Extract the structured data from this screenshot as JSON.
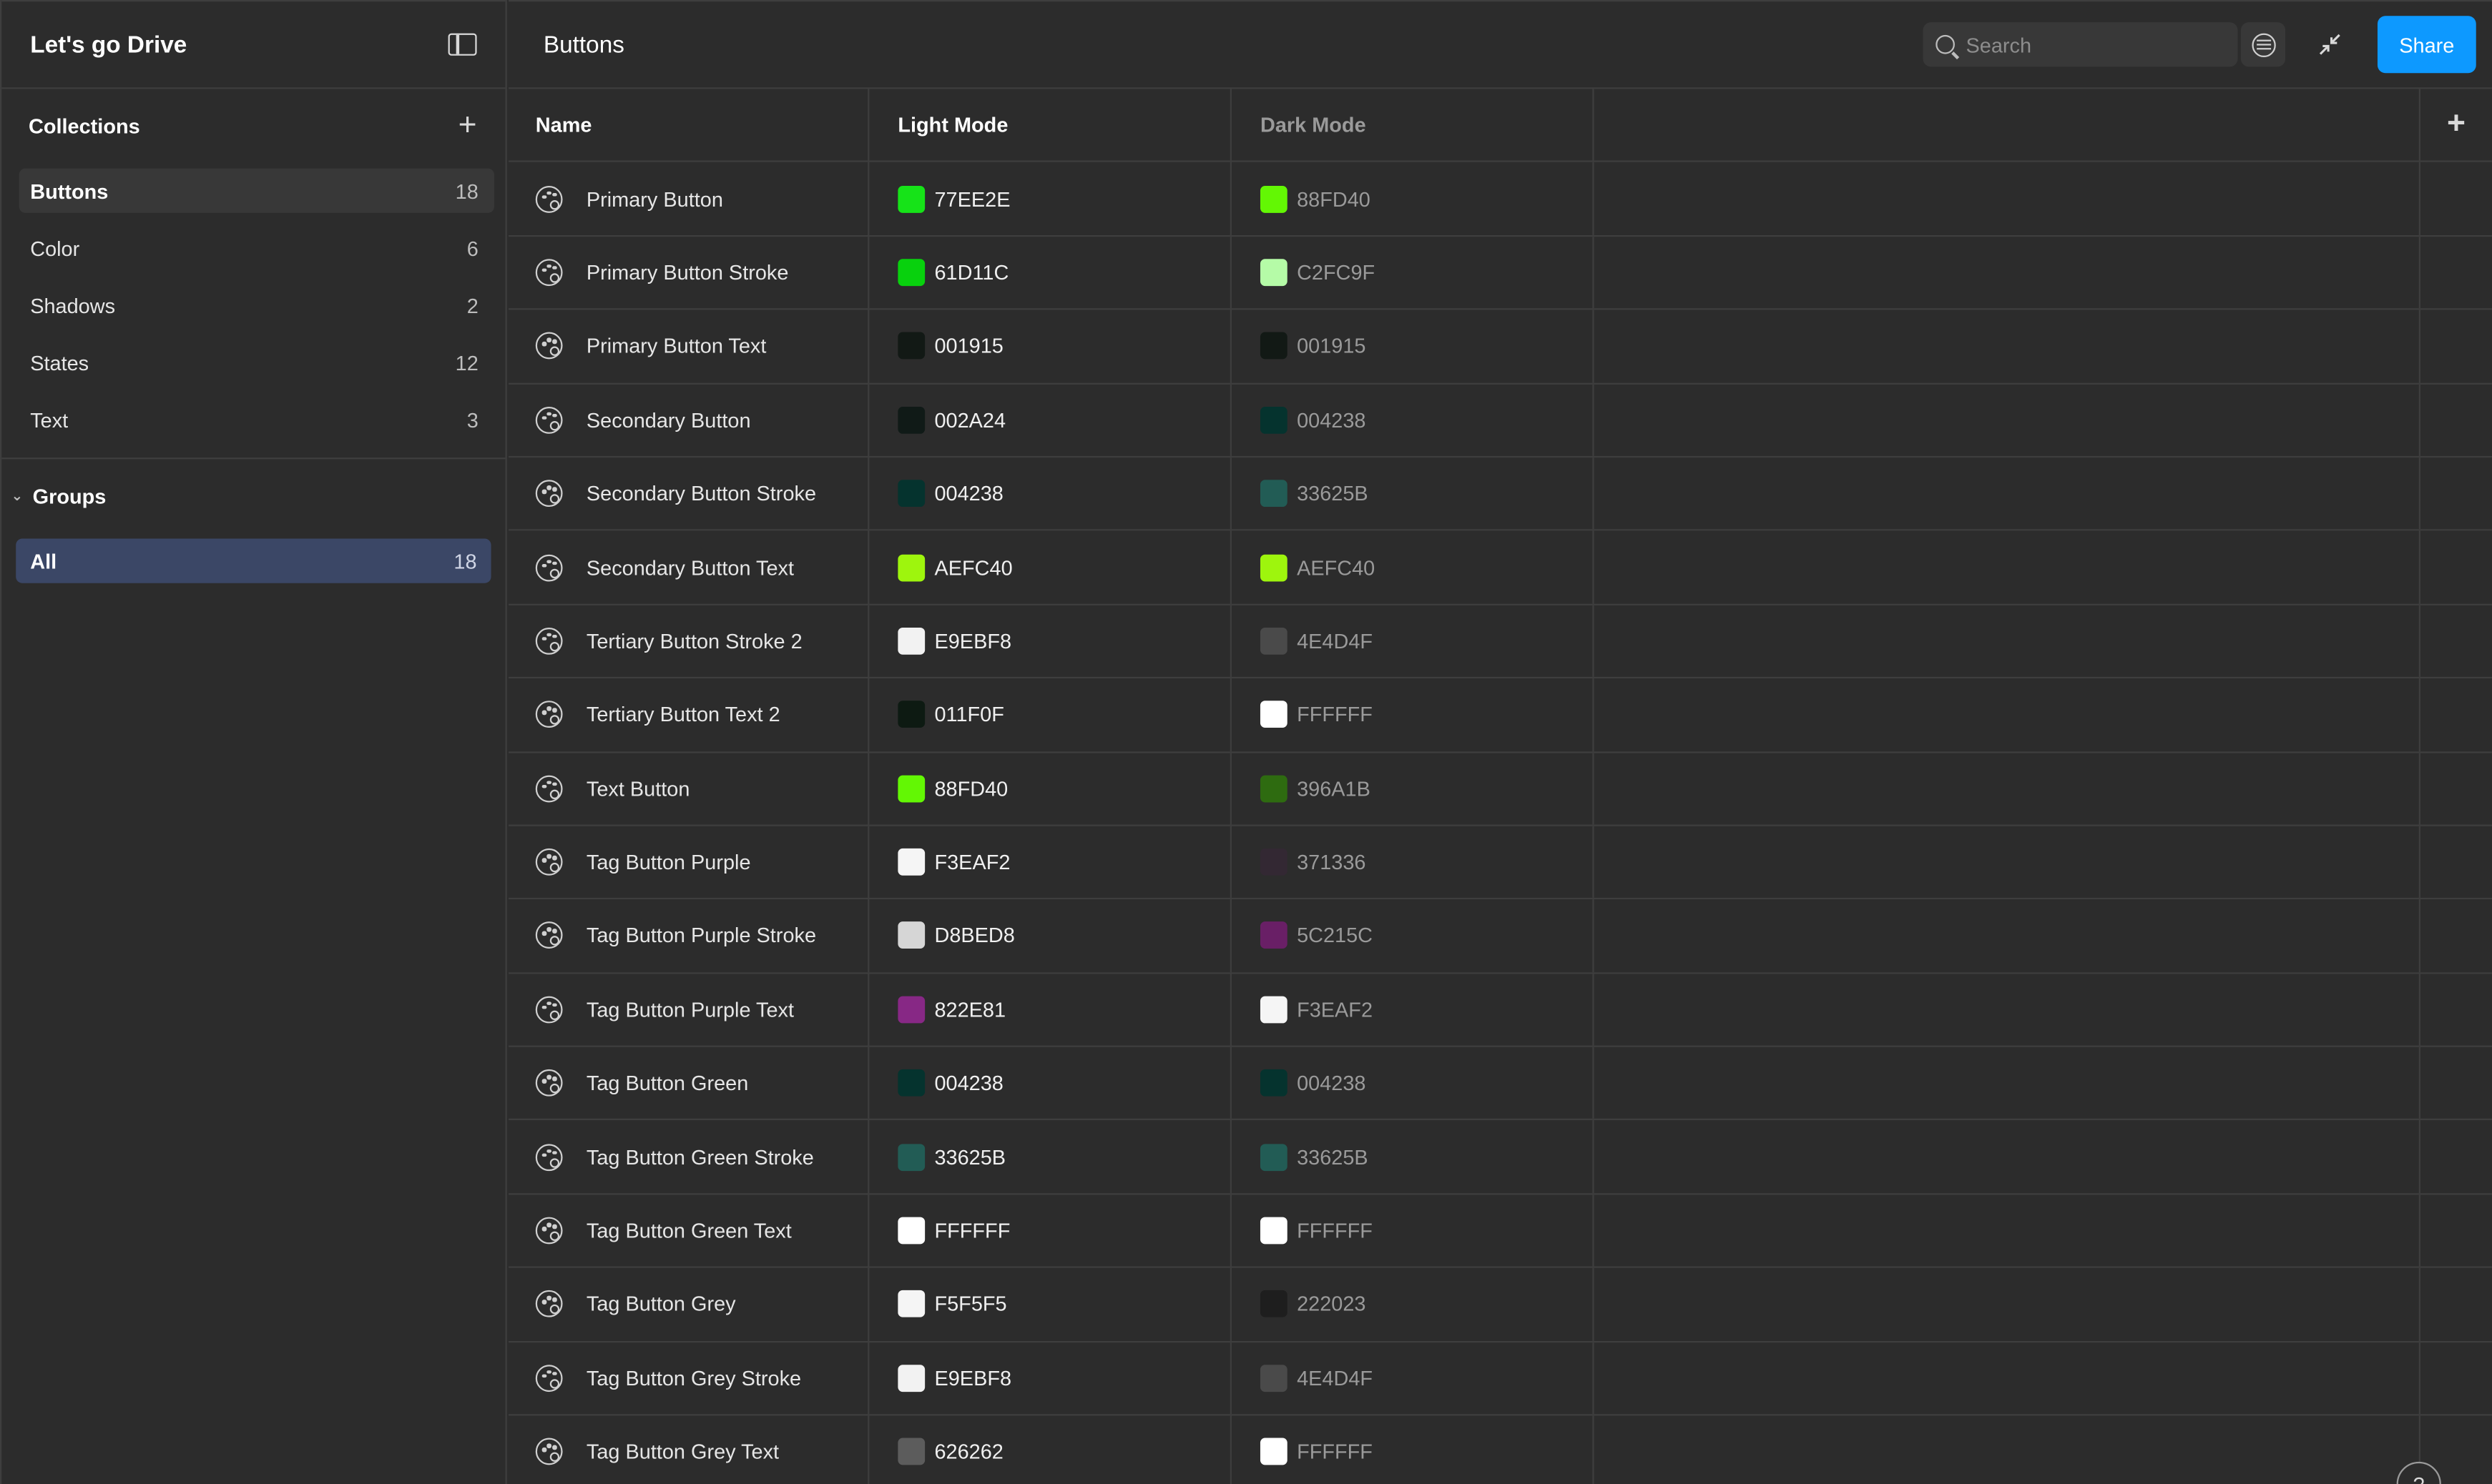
{
  "app": {
    "title": "Let's go Drive"
  },
  "sidebar": {
    "collections_label": "Collections",
    "collections": [
      {
        "label": "Buttons",
        "count": "18",
        "active": true
      },
      {
        "label": "Color",
        "count": "6"
      },
      {
        "label": "Shadows",
        "count": "2"
      },
      {
        "label": "States",
        "count": "12"
      },
      {
        "label": "Text",
        "count": "3"
      }
    ],
    "groups_label": "Groups",
    "groups": [
      {
        "label": "All",
        "count": "18",
        "active": true
      }
    ]
  },
  "header": {
    "title": "Buttons",
    "search_placeholder": "Search",
    "share_label": "Share"
  },
  "table": {
    "columns": [
      "Name",
      "Light Mode",
      "Dark Mode"
    ],
    "rows": [
      {
        "name": "Primary Button",
        "light": "77EE2E",
        "dark": "88FD40",
        "light_color": "#16e318",
        "dark_color": "#63f704"
      },
      {
        "name": "Primary Button Stroke",
        "light": "61D11C",
        "dark": "C2FC9F",
        "light_color": "#08d10d",
        "dark_color": "#b5fba7"
      },
      {
        "name": "Primary Button Text",
        "light": "001915",
        "dark": "001915",
        "light_color": "#121915",
        "dark_color": "#121915"
      },
      {
        "name": "Secondary Button",
        "light": "002A24",
        "dark": "004238",
        "light_color": "#101a17",
        "dark_color": "#05332e"
      },
      {
        "name": "Secondary Button Stroke",
        "light": "004238",
        "dark": "33625B",
        "light_color": "#05332e",
        "dark_color": "#225c55"
      },
      {
        "name": "Secondary Button Text",
        "light": "AEFC40",
        "dark": "AEFC40",
        "light_color": "#9ef50d",
        "dark_color": "#9ef50d"
      },
      {
        "name": "Tertiary Button Stroke 2",
        "light": "E9EBF8",
        "dark": "4E4D4F",
        "light_color": "#f2f2f2",
        "dark_color": "#4a4a4a"
      },
      {
        "name": "Tertiary Button Text 2",
        "light": "011F0F",
        "dark": "FFFFFF",
        "light_color": "#0d1a12",
        "dark_color": "#ffffff"
      },
      {
        "name": "Text Button",
        "light": "88FD40",
        "dark": "396A1B",
        "light_color": "#63f704",
        "dark_color": "#2e6b10"
      },
      {
        "name": "Tag Button Purple",
        "light": "F3EAF2",
        "dark": "371336",
        "light_color": "#f5f5f5",
        "dark_color": "#332833"
      },
      {
        "name": "Tag Button Purple Stroke",
        "light": "D8BED8",
        "dark": "5C215C",
        "light_color": "#d6d6d6",
        "dark_color": "#691f66"
      },
      {
        "name": "Tag Button Purple Text",
        "light": "822E81",
        "dark": "F3EAF2",
        "light_color": "#872885",
        "dark_color": "#f5f5f5"
      },
      {
        "name": "Tag Button Green",
        "light": "004238",
        "dark": "004238",
        "light_color": "#05332e",
        "dark_color": "#05332e"
      },
      {
        "name": "Tag Button Green Stroke",
        "light": "33625B",
        "dark": "33625B",
        "light_color": "#225c55",
        "dark_color": "#225c55"
      },
      {
        "name": "Tag Button Green Text",
        "light": "FFFFFF",
        "dark": "FFFFFF",
        "light_color": "#ffffff",
        "dark_color": "#ffffff"
      },
      {
        "name": "Tag Button Grey",
        "light": "F5F5F5",
        "dark": "222023",
        "light_color": "#f5f5f5",
        "dark_color": "#1e1e1e"
      },
      {
        "name": "Tag Button Grey Stroke",
        "light": "E9EBF8",
        "dark": "4E4D4F",
        "light_color": "#f2f2f2",
        "dark_color": "#4a4a4a"
      },
      {
        "name": "Tag Button Grey Text",
        "light": "626262",
        "dark": "FFFFFF",
        "light_color": "#5c5c5c",
        "dark_color": "#ffffff"
      }
    ]
  },
  "help": {
    "label": "?"
  },
  "colors": {
    "accent": "#0d99ff",
    "group_active_bg": "#3b4766"
  }
}
